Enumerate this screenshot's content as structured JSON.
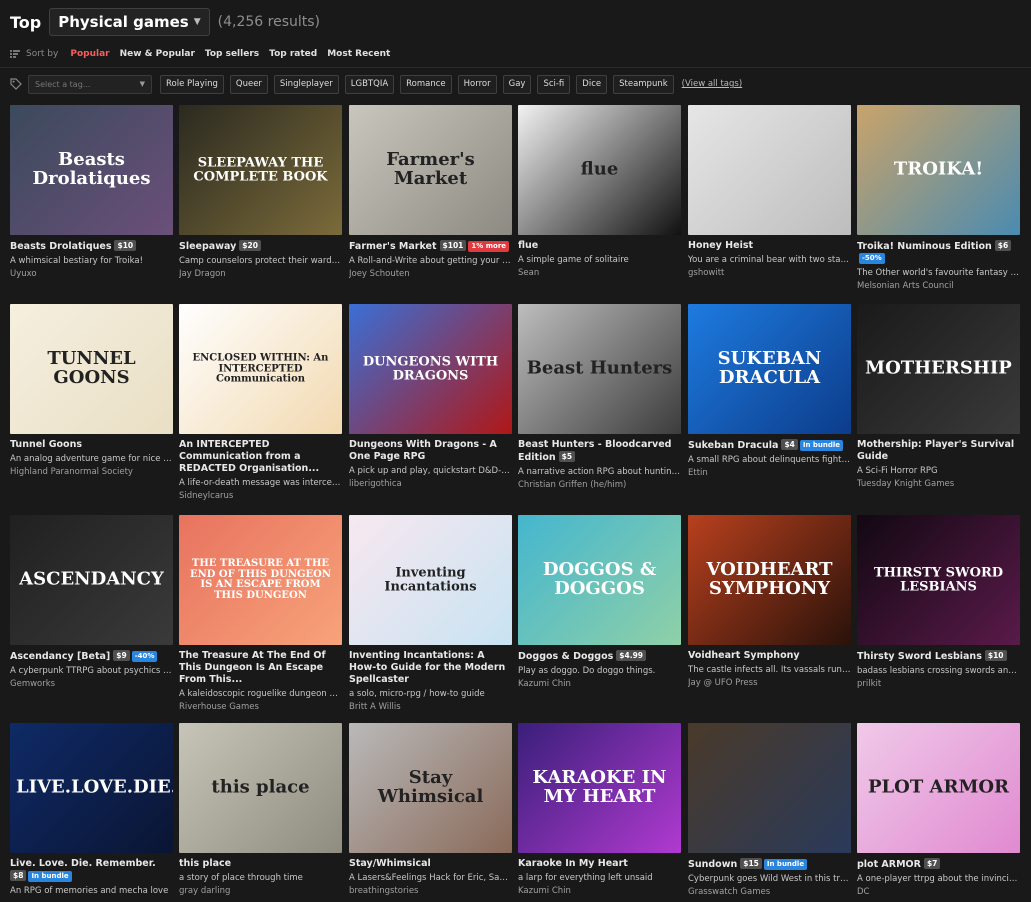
{
  "header": {
    "top_label": "Top",
    "category": "Physical games",
    "results": "(4,256 results)"
  },
  "sort": {
    "label": "Sort by",
    "tabs": [
      "Popular",
      "New & Popular",
      "Top sellers",
      "Top rated",
      "Most Recent"
    ],
    "active": "Popular"
  },
  "tags": {
    "placeholder": "Select a tag...",
    "items": [
      "Role Playing",
      "Queer",
      "Singleplayer",
      "LGBTQIA",
      "Romance",
      "Horror",
      "Gay",
      "Sci-fi",
      "Dice",
      "Steampunk"
    ],
    "view_all": "(View all tags)"
  },
  "colors": {
    "background": "#191919",
    "accent": "#fa5c5c",
    "sale_badge": "#e0393e",
    "bundle_badge": "#2a85de"
  },
  "games": [
    {
      "title": "Beasts Drolatiques",
      "price": "$10",
      "desc": "A whimsical bestiary for Troika!",
      "author": "Uyuxo",
      "cover_text": "Beasts Drolatiques",
      "bg": "#3b4a5c",
      "bg2": "#6b4f7a"
    },
    {
      "title": "Sleepaway",
      "price": "$20",
      "desc": "Camp counselors protect their wards fro...",
      "author": "Jay Dragon",
      "cover_text": "SLEEPAWAY THE COMPLETE BOOK",
      "bg": "#2b2a20",
      "bg2": "#7b6b3a"
    },
    {
      "title": "Farmer's Market",
      "price": "$101",
      "badge": "1% more",
      "badge_color": "red",
      "desc": "A Roll-and-Write about getting your crop...",
      "author": "Joey Schouten",
      "cover_text": "Farmer's Market",
      "bg": "#c9c6bd",
      "bg2": "#8d8a82"
    },
    {
      "title": "flue",
      "desc": "A simple game of solitaire",
      "author": "Sean",
      "cover_text": "flue",
      "bg": "#f2f2f2",
      "bg2": "#111111"
    },
    {
      "title": "Honey Heist",
      "desc": "You are a criminal bear with two stats: C...",
      "author": "gshowitt",
      "cover_text": "",
      "bg": "#e6e6e6",
      "bg2": "#bdbdbd"
    },
    {
      "title": "Troika! Numinous Edition",
      "price": "$6",
      "badge": "-50%",
      "badge_color": "blue",
      "desc": "The Other world's favourite fantasy role-...",
      "author": "Melsonian Arts Council",
      "cover_text": "TROIKA!",
      "bg": "#c9a36a",
      "bg2": "#4b8bb0"
    },
    {
      "title": "Tunnel Goons",
      "desc": "An analog adventure game for nice people",
      "author": "Highland Paranormal Society",
      "cover_text": "TUNNEL GOONS",
      "bg": "#f5efdf",
      "bg2": "#e9dfc4"
    },
    {
      "title": "An INTERCEPTED Communication from a REDACTED Organisation...",
      "desc": "A life-or-death message was intercepted....",
      "author": "Sidneylcarus",
      "cover_text": "ENCLOSED WITHIN: An INTERCEPTED Communication",
      "bg": "#ffffff",
      "bg2": "#f2d9b0"
    },
    {
      "title": "Dungeons With Dragons - A One Page RPG",
      "desc": "A pick up and play, quickstart D&D-like ta...",
      "author": "liberigothica",
      "cover_text": "DUNGEONS WITH DRAGONS",
      "bg": "#3a6fd6",
      "bg2": "#b01717"
    },
    {
      "title": "Beast Hunters - Bloodcarved Edition",
      "price": "$5",
      "desc": "A narrative action RPG about hunting mo...",
      "author": "Christian Griffen (he/him)",
      "cover_text": "Beast Hunters",
      "bg": "#bdbdbd",
      "bg2": "#3c3c3c"
    },
    {
      "title": "Sukeban Dracula",
      "price": "$4",
      "badge": "In bundle",
      "badge_color": "blue",
      "desc": "A small RPG about delinquents fighting D...",
      "author": "Ettin",
      "cover_text": "SUKEBAN DRACULA",
      "bg": "#1e7be0",
      "bg2": "#0c3c8a"
    },
    {
      "title": "Mothership: Player's Survival Guide",
      "desc": "A Sci-Fi Horror RPG",
      "author": "Tuesday Knight Games",
      "cover_text": "MOTHERSHIP",
      "bg": "#1a1a1a",
      "bg2": "#3a3a3a"
    },
    {
      "title": "Ascendancy [Beta]",
      "price": "$9",
      "badge": "-40%",
      "badge_color": "blue",
      "desc": "A cyberpunk TTRPG about psychics and i...",
      "author": "Gemworks",
      "cover_text": "ASCENDANCY",
      "bg": "#202020",
      "bg2": "#3a3a3a"
    },
    {
      "title": "The Treasure At The End Of This Dungeon Is An Escape From This...",
      "desc": "A kaleidoscopic roguelike dungeon crawl",
      "author": "Riverhouse Games",
      "cover_text": "THE TREASURE AT THE END OF THIS DUNGEON IS AN ESCAPE FROM THIS DUNGEON",
      "bg": "#e8735f",
      "bg2": "#f7a37a"
    },
    {
      "title": "Inventing Incantations: A How-to Guide for the Modern Spellcaster",
      "desc": "a solo, micro-rpg / how-to guide",
      "author": "Britt A Willis",
      "cover_text": "Inventing Incantations",
      "bg": "#f7e8f0",
      "bg2": "#c8e3f2"
    },
    {
      "title": "Doggos & Doggos",
      "price": "$4.99",
      "desc": "Play as doggo. Do doggo things.",
      "author": "Kazumi Chin",
      "cover_text": "DOGGOS & DOGGOS",
      "bg": "#45b6ce",
      "bg2": "#8fd0a8"
    },
    {
      "title": "Voidheart Symphony",
      "desc": "The castle infects all. Its vassals run this c...",
      "author": "Jay @ UFO Press",
      "cover_text": "VOIDHEART SYMPHONY",
      "bg": "#b8401e",
      "bg2": "#2a120a"
    },
    {
      "title": "Thirsty Sword Lesbians",
      "price": "$10",
      "desc": "badass lesbians crossing swords and falli...",
      "author": "prilkit",
      "cover_text": "THIRSTY SWORD LESBIANS",
      "bg": "#120812",
      "bg2": "#5a1a4a"
    },
    {
      "title": "Live. Love. Die. Remember.",
      "price": "$8",
      "badge": "In bundle",
      "badge_color": "blue",
      "desc": "An RPG of memories and mecha love",
      "author": "",
      "cover_text": "LIVE.LOVE.DIE.",
      "bg": "#0f2a66",
      "bg2": "#0a1533"
    },
    {
      "title": "this place",
      "desc": "a story of place through time",
      "author": "gray darling",
      "cover_text": "this place",
      "bg": "#c7c5b8",
      "bg2": "#8f8c80"
    },
    {
      "title": "Stay/Whimsical",
      "desc": "A Lasers&Feelings Hack for Eric, Sam, Gi...",
      "author": "breathingstories",
      "cover_text": "Stay Whimsical",
      "bg": "#b9b9b9",
      "bg2": "#8a6a5a"
    },
    {
      "title": "Karaoke In My Heart",
      "desc": "a larp for everything left unsaid",
      "author": "Kazumi Chin",
      "cover_text": "KARAOKE IN MY HEART",
      "bg": "#3a1f7a",
      "bg2": "#b03ad0"
    },
    {
      "title": "Sundown",
      "price": "$15",
      "badge": "In bundle",
      "badge_color": "blue",
      "desc": "Cyberpunk goes Wild West in this transh...",
      "author": "Grasswatch Games",
      "cover_text": "",
      "bg": "#4a3a2a",
      "bg2": "#2a3a5a"
    },
    {
      "title": "plot ARMOR",
      "price": "$7",
      "desc": "A one-player ttrpg about the invincibility ...",
      "author": "DC",
      "cover_text": "PLOT ARMOR",
      "bg": "#f0c9e9",
      "bg2": "#e08ad0"
    }
  ]
}
